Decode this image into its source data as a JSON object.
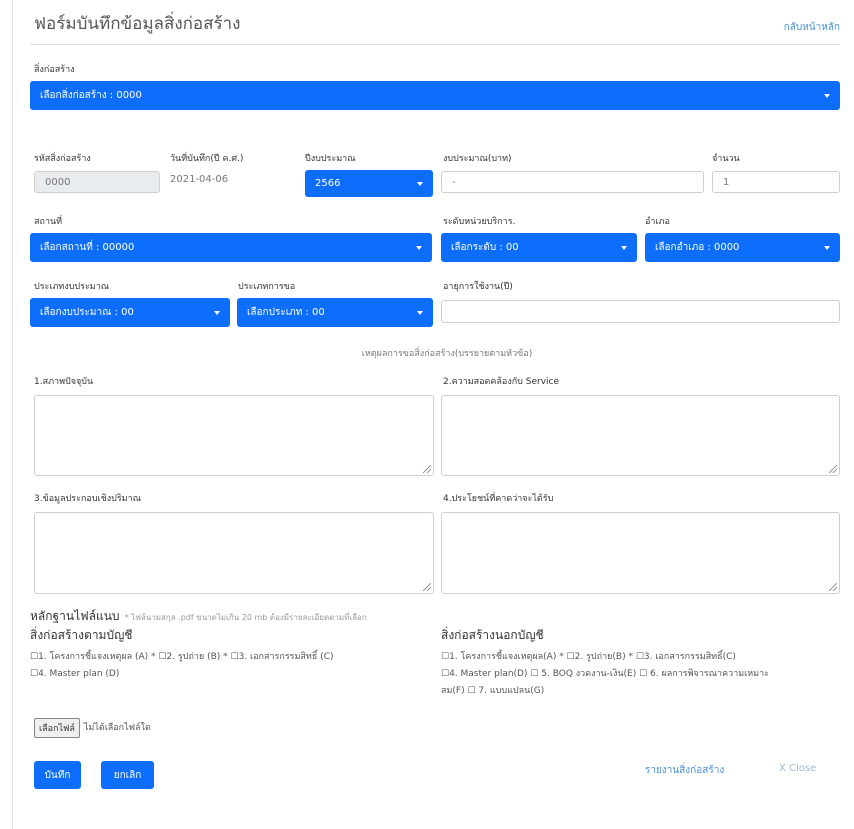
{
  "header": {
    "title": "ฟอร์มบันทึกข้อมูลสิ่งก่อสร้าง",
    "back_link": "กลับหน้าหลัก"
  },
  "building": {
    "label": "สิ่งก่อสร้าง",
    "selected": "เลือกสิ่งก่อสร้าง : 0000"
  },
  "row1": {
    "code_label": "รหัสสิ่งก่อสร้าง",
    "code_value": "0000",
    "date_label": "วันที่บันทึก(ปี ค.ศ.)",
    "date_value": "2021-04-06",
    "fiscal_label": "ปีงบประมาณ",
    "fiscal_value": "2566",
    "budget_label": "งบประมาณ(บาท)",
    "budget_value": "-",
    "qty_label": "จำนวน",
    "qty_value": "1"
  },
  "row2": {
    "place_label": "สถานที่",
    "place_value": "เลือกสถานที่ : 00000",
    "level_label": "ระดับหน่วยบริการ.",
    "level_value": "เลือกระดับ : 00",
    "district_label": "อำเภอ",
    "district_value": "เลือกอำเภอ : 0000"
  },
  "row3": {
    "budget_type_label": "ประเภทงบประมาณ",
    "budget_type_value": "เลือกงบประมาณ : 00",
    "request_type_label": "ประเภทการขอ",
    "request_type_value": "เลือกประเภท : 00",
    "life_label": "อายุการใช้งาน(ปี)"
  },
  "reasons": {
    "heading": "เหตุผลการขอสิ่งก่อสร้าง(บรรยายตามหัวข้อ)",
    "r1": "1.สภาพปัจจุบัน",
    "r2": "2.ความสอดคล้องกับ Service",
    "r3": "3.ข้อมูลประกอบเชิงปริมาณ",
    "r4": "4.ประโยชน์ที่คาดว่าจะได้รับ"
  },
  "attachments": {
    "title": "หลักฐานไฟล์แนบ",
    "note": "* ไฟล์นามสกุล .pdf ขนาดไม่เกิน 20 mb ต้องมีรายละเอียดตามที่เลือก",
    "in_list_title": "สิ่งก่อสร้างตามบัญชี",
    "in_list_line1": "☐1. โครงการชี้แจงเหตุผล (A) * ☐2. รูปถ่าย (B) * ☐3. เอกสารกรรมสิทธิ์ (C)",
    "in_list_line2": "☐4. Master plan (D)",
    "out_list_title": "สิ่งก่อสร้างนอกบัญชี",
    "out_list_line1": "☐1. โครงการชี้แจงเหตุผล(A) * ☐2. รูปถ่าย(B) * ☐3. เอกสารกรรมสิทธิ์(C)",
    "out_list_line2": "☐4. Master plan(D) ☐ 5. BOQ งวดงาน-เงิน(E) ☐ 6. ผลการพิจารณาความเหมาะ",
    "out_list_line3": "สม(F) ☐ 7. แบบแปลน(G)",
    "file_button": "เลือกไฟล์",
    "file_status": "ไม่ได้เลือกไฟล์ใด"
  },
  "footer": {
    "save": "บันทึก",
    "cancel": "ยกเลิก",
    "report": "รายงานสิ่งก่อสร้าง",
    "close": "X Close"
  }
}
